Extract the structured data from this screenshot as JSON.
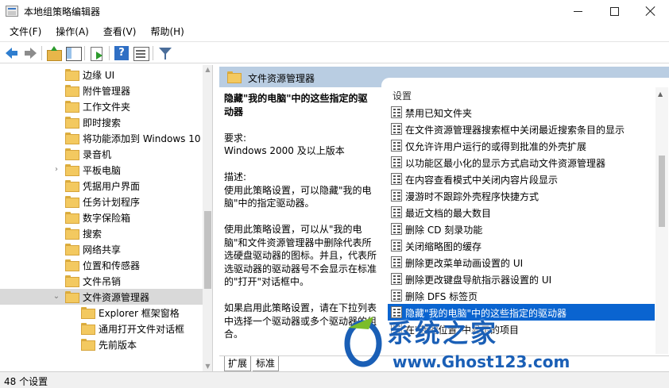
{
  "window": {
    "title": "本地组策略编辑器"
  },
  "menu": {
    "file": "文件(F)",
    "action": "操作(A)",
    "view": "查看(V)",
    "help": "帮助(H)"
  },
  "tree": {
    "items": [
      {
        "label": "边缘 UI"
      },
      {
        "label": "附件管理器"
      },
      {
        "label": "工作文件夹"
      },
      {
        "label": "即时搜索"
      },
      {
        "label": "将功能添加到 Windows 10"
      },
      {
        "label": "录音机"
      },
      {
        "label": "平板电脑",
        "expander": "›"
      },
      {
        "label": "凭据用户界面"
      },
      {
        "label": "任务计划程序"
      },
      {
        "label": "数字保险箱"
      },
      {
        "label": "搜索"
      },
      {
        "label": "网络共享"
      },
      {
        "label": "位置和传感器"
      },
      {
        "label": "文件吊销"
      },
      {
        "label": "文件资源管理器",
        "expander": "⌄",
        "selected": true
      },
      {
        "label": "Explorer 框架窗格"
      },
      {
        "label": "通用打开文件对话框"
      },
      {
        "label": "先前版本"
      }
    ]
  },
  "right": {
    "header_title": "文件资源管理器",
    "description": {
      "title": "隐藏\"我的电脑\"中的这些指定的驱动器",
      "req_label": "要求:",
      "req_value": "Windows 2000 及以上版本",
      "desc_label": "描述:",
      "desc_p1": "使用此策略设置，可以隐藏\"我的电脑\"中的指定驱动器。",
      "desc_p2": "使用此策略设置，可以从\"我的电脑\"和文件资源管理器中删除代表所选硬盘驱动器的图标。并且，代表所选驱动器的驱动器号不会显示在标准的\"打开\"对话框中。",
      "desc_p3": "如果启用此策略设置，请在下拉列表中选择一个驱动器或多个驱动器的组合。"
    },
    "column_header": "设置",
    "settings": [
      "禁用已知文件夹",
      "在文件资源管理器搜索框中关闭最近搜索条目的显示",
      "仅允许许用户运行的或得到批准的外壳扩展",
      "以功能区最小化的显示方式启动文件资源管理器",
      "在内容查看模式中关闭内容片段显示",
      "漫游时不跟踪外壳程序快捷方式",
      "最近文档的最大数目",
      "删除 CD 刻录功能",
      "关闭缩略图的缓存",
      "删除更改菜单动画设置的 UI",
      "删除更改键盘导航指示器设置的 UI",
      "删除 DFS 标签页",
      "隐藏\"我的电脑\"中的这些指定的驱动器",
      "在\"我的位置\"中显示的项目"
    ],
    "selected_index": 12,
    "tabs": {
      "extended": "扩展",
      "standard": "标准"
    }
  },
  "status": {
    "text": "48 个设置"
  },
  "watermark": {
    "text": "系统之家",
    "url": "www.Ghost123.com"
  },
  "colors": {
    "selection": "#0a64d0",
    "header_band": "#b9cde2",
    "folder": "#f3c960",
    "watermark": "#1a5fb6"
  }
}
